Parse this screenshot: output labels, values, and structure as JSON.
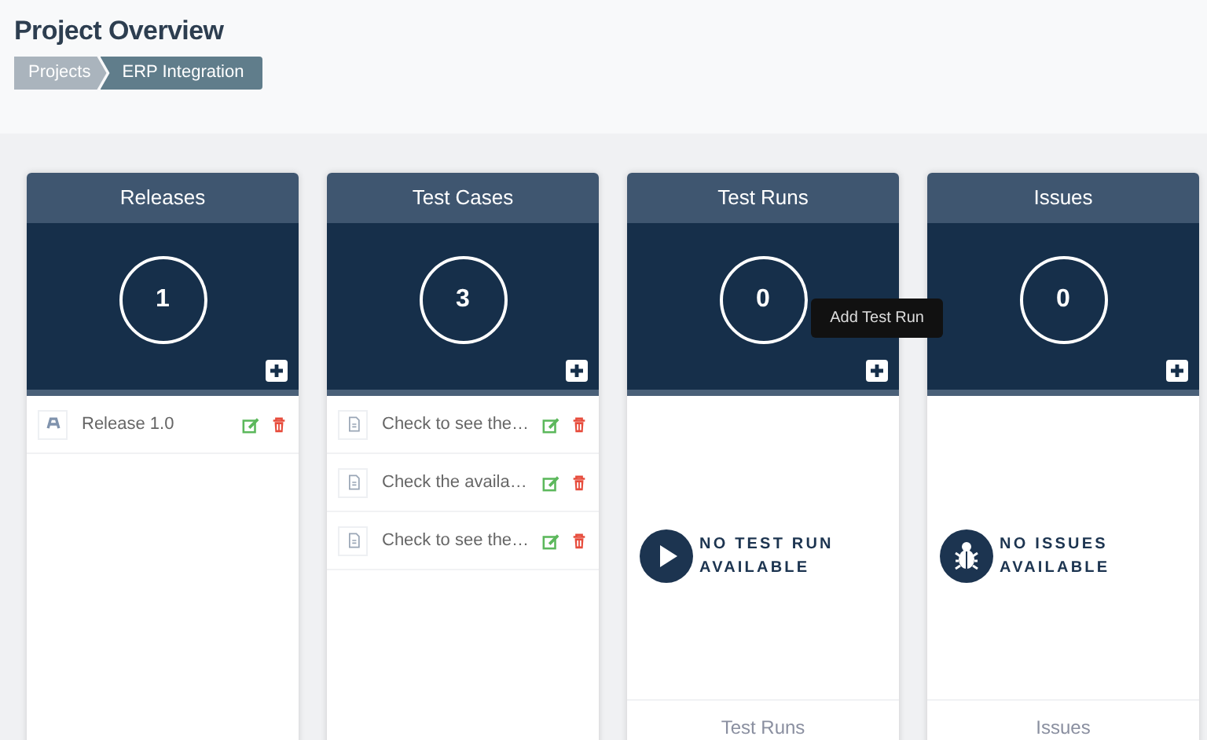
{
  "page_title": "Project Overview",
  "breadcrumb": [
    {
      "label": "Projects",
      "selected": false
    },
    {
      "label": "ERP Integration",
      "selected": true
    }
  ],
  "panels": [
    {
      "title": "Releases",
      "count": "1",
      "items": [
        {
          "kind": "release",
          "text": "Release 1.0"
        }
      ]
    },
    {
      "title": "Test Cases",
      "count": "3",
      "items": [
        {
          "kind": "test-case",
          "text": "Check to see the…"
        },
        {
          "kind": "test-case",
          "text": "Check the availa…"
        },
        {
          "kind": "test-case",
          "text": "Check to see the…"
        }
      ]
    },
    {
      "title": "Test Runs",
      "count": "0",
      "tooltip": "Add Test Run",
      "empty": {
        "kind": "play",
        "text": "NO TEST RUN AVAILABLE"
      },
      "footer": "Test Runs"
    },
    {
      "title": "Issues",
      "count": "0",
      "empty": {
        "kind": "bug",
        "text": "NO ISSUES AVAILABLE"
      },
      "footer": "Issues"
    }
  ]
}
